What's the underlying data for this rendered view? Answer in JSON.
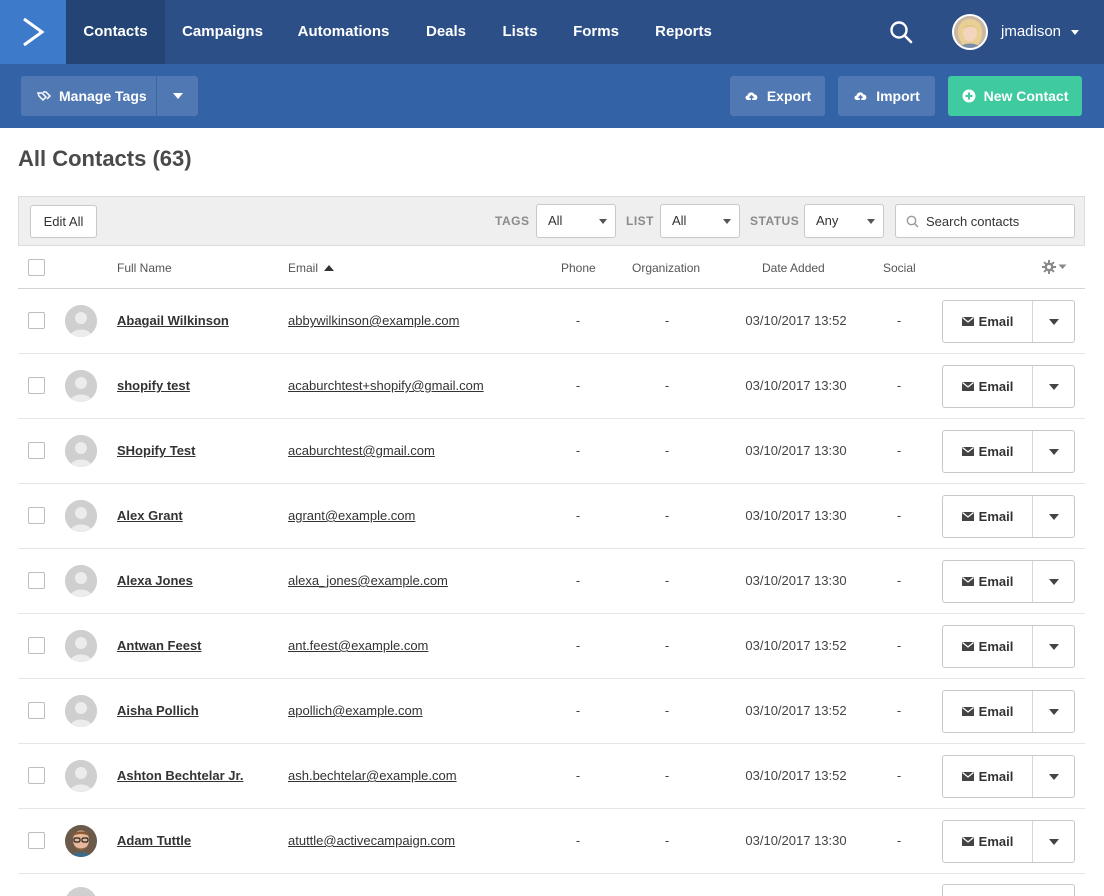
{
  "nav": {
    "items": [
      {
        "label": "Contacts",
        "active": true
      },
      {
        "label": "Campaigns",
        "active": false
      },
      {
        "label": "Automations",
        "active": false
      },
      {
        "label": "Deals",
        "active": false
      },
      {
        "label": "Lists",
        "active": false
      },
      {
        "label": "Forms",
        "active": false
      },
      {
        "label": "Reports",
        "active": false
      }
    ],
    "user": {
      "name": "jmadison"
    }
  },
  "toolbar": {
    "manage_tags_label": "Manage Tags",
    "export_label": "Export",
    "import_label": "Import",
    "new_contact_label": "New Contact"
  },
  "page": {
    "title": "All Contacts (63)"
  },
  "filters": {
    "edit_all_label": "Edit All",
    "tags_label": "TAGS",
    "tags_value": "All",
    "list_label": "LIST",
    "list_value": "All",
    "status_label": "STATUS",
    "status_value": "Any",
    "search_placeholder": "Search contacts"
  },
  "table": {
    "columns": {
      "full_name": "Full Name",
      "email": "Email",
      "phone": "Phone",
      "organization": "Organization",
      "date_added": "Date Added",
      "social": "Social"
    },
    "sort": {
      "column": "Email",
      "direction": "ascending"
    },
    "action_label": "Email",
    "rows": [
      {
        "name": "Abagail Wilkinson",
        "email": "abbywilkinson@example.com",
        "phone": "-",
        "organization": "-",
        "date_added": "03/10/2017 13:52",
        "social": "-",
        "avatar": "default"
      },
      {
        "name": "shopify test",
        "email": "acaburchtest+shopify@gmail.com",
        "phone": "-",
        "organization": "-",
        "date_added": "03/10/2017 13:30",
        "social": "-",
        "avatar": "default"
      },
      {
        "name": "SHopify Test",
        "email": "acaburchtest@gmail.com",
        "phone": "-",
        "organization": "-",
        "date_added": "03/10/2017 13:30",
        "social": "-",
        "avatar": "default"
      },
      {
        "name": "Alex Grant",
        "email": "agrant@example.com",
        "phone": "-",
        "organization": "-",
        "date_added": "03/10/2017 13:30",
        "social": "-",
        "avatar": "default"
      },
      {
        "name": "Alexa Jones",
        "email": "alexa_jones@example.com",
        "phone": "-",
        "organization": "-",
        "date_added": "03/10/2017 13:30",
        "social": "-",
        "avatar": "default"
      },
      {
        "name": "Antwan Feest",
        "email": "ant.feest@example.com",
        "phone": "-",
        "organization": "-",
        "date_added": "03/10/2017 13:52",
        "social": "-",
        "avatar": "default"
      },
      {
        "name": "Aisha Pollich",
        "email": "apollich@example.com",
        "phone": "-",
        "organization": "-",
        "date_added": "03/10/2017 13:52",
        "social": "-",
        "avatar": "default"
      },
      {
        "name": "Ashton Bechtelar Jr.",
        "email": "ash.bechtelar@example.com",
        "phone": "-",
        "organization": "-",
        "date_added": "03/10/2017 13:52",
        "social": "-",
        "avatar": "default"
      },
      {
        "name": "Adam Tuttle",
        "email": "atuttle@activecampaign.com",
        "phone": "-",
        "organization": "-",
        "date_added": "03/10/2017 13:30",
        "social": "-",
        "avatar": "photo"
      }
    ]
  },
  "colors": {
    "nav_bg": "#2c4f87",
    "nav_active": "#234474",
    "logo_bg": "#3d7ac9",
    "toolbar_bg": "#3363a6",
    "button_bg": "#5079b4",
    "new_contact_bg": "#3fcaa0"
  },
  "icons": [
    "logo-icon",
    "search-icon",
    "tag-icon",
    "cloud-upload-icon",
    "plus-circle-icon",
    "gear-icon",
    "envelope-icon",
    "chevron-down-icon",
    "person-placeholder-icon"
  ]
}
